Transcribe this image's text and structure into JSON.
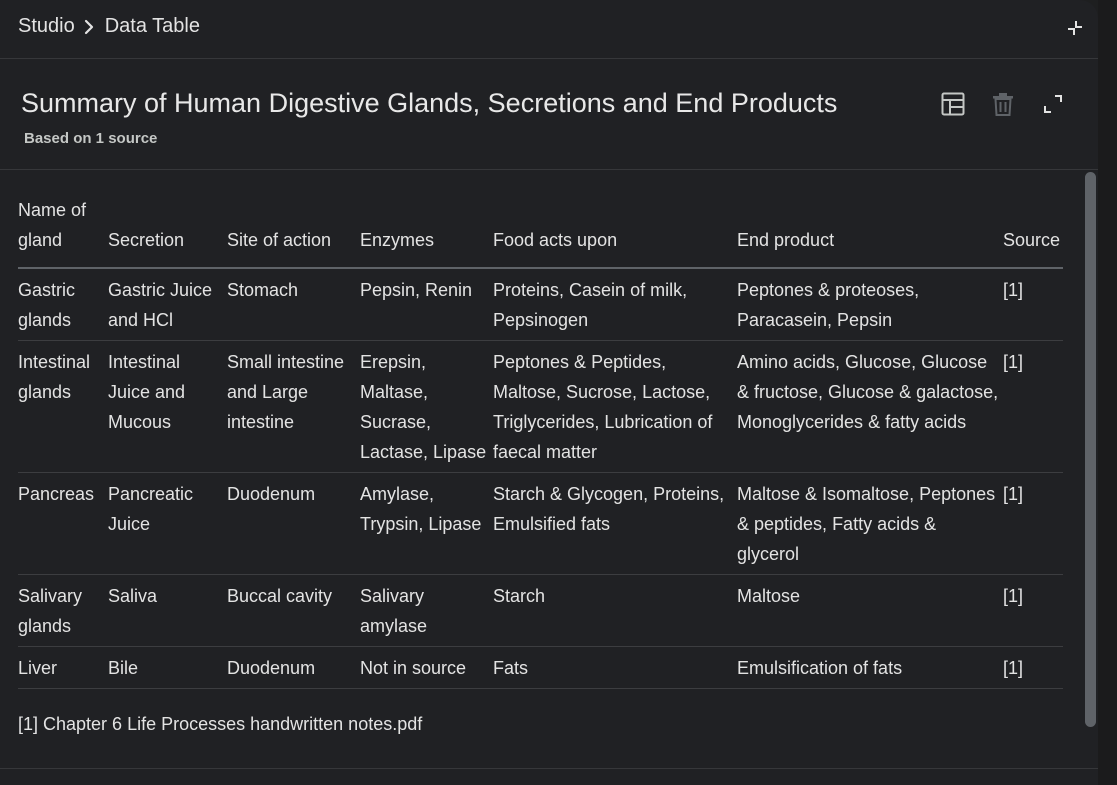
{
  "breadcrumb": {
    "root": "Studio",
    "current": "Data Table"
  },
  "document": {
    "title": "Summary of Human Digestive Glands, Secretions and End Products",
    "subtitle": "Based on 1 source"
  },
  "icons": {
    "collapse": "collapse-icon",
    "table": "table-icon",
    "delete": "trash-icon",
    "expand": "expand-icon",
    "chevron": "chevron-right-icon"
  },
  "table": {
    "headers": [
      "Name of gland",
      "Secretion",
      "Site of action",
      "Enzymes",
      "Food acts upon",
      "End product",
      "Source"
    ],
    "rows": [
      [
        "Gastric glands",
        "Gastric Juice and HCl",
        "Stomach",
        "Pepsin, Renin",
        "Proteins, Casein of milk, Pepsinogen",
        "Peptones & proteoses, Paracasein, Pepsin",
        "[1]"
      ],
      [
        "Intestinal glands",
        "Intestinal Juice and Mucous",
        "Small intestine and Large intestine",
        "Erepsin, Maltase, Sucrase, Lactase, Lipase",
        "Peptones & Peptides, Maltose, Sucrose, Lactose, Triglycerides, Lubrication of faecal matter",
        "Amino acids, Glucose, Glucose & fructose, Glucose & galactose, Monoglycerides & fatty acids",
        "[1]"
      ],
      [
        "Pancreas",
        "Pancreatic Juice",
        "Duodenum",
        "Amylase, Trypsin, Lipase",
        "Starch & Glycogen, Proteins, Emulsified fats",
        "Maltose & Isomaltose, Peptones & peptides, Fatty acids & glycerol",
        "[1]"
      ],
      [
        "Salivary glands",
        "Saliva",
        "Buccal cavity",
        "Salivary amylase",
        "Starch",
        "Maltose",
        "[1]"
      ],
      [
        "Liver",
        "Bile",
        "Duodenum",
        "Not in source",
        "Fats",
        "Emulsification of fats",
        "[1]"
      ]
    ]
  },
  "footnote": "[1] Chapter 6 Life Processes handwritten notes.pdf",
  "colors": {
    "background": "#202124",
    "text": "#e3e3e3",
    "muted": "#c4c7c5",
    "divider": "#3c3d40"
  }
}
